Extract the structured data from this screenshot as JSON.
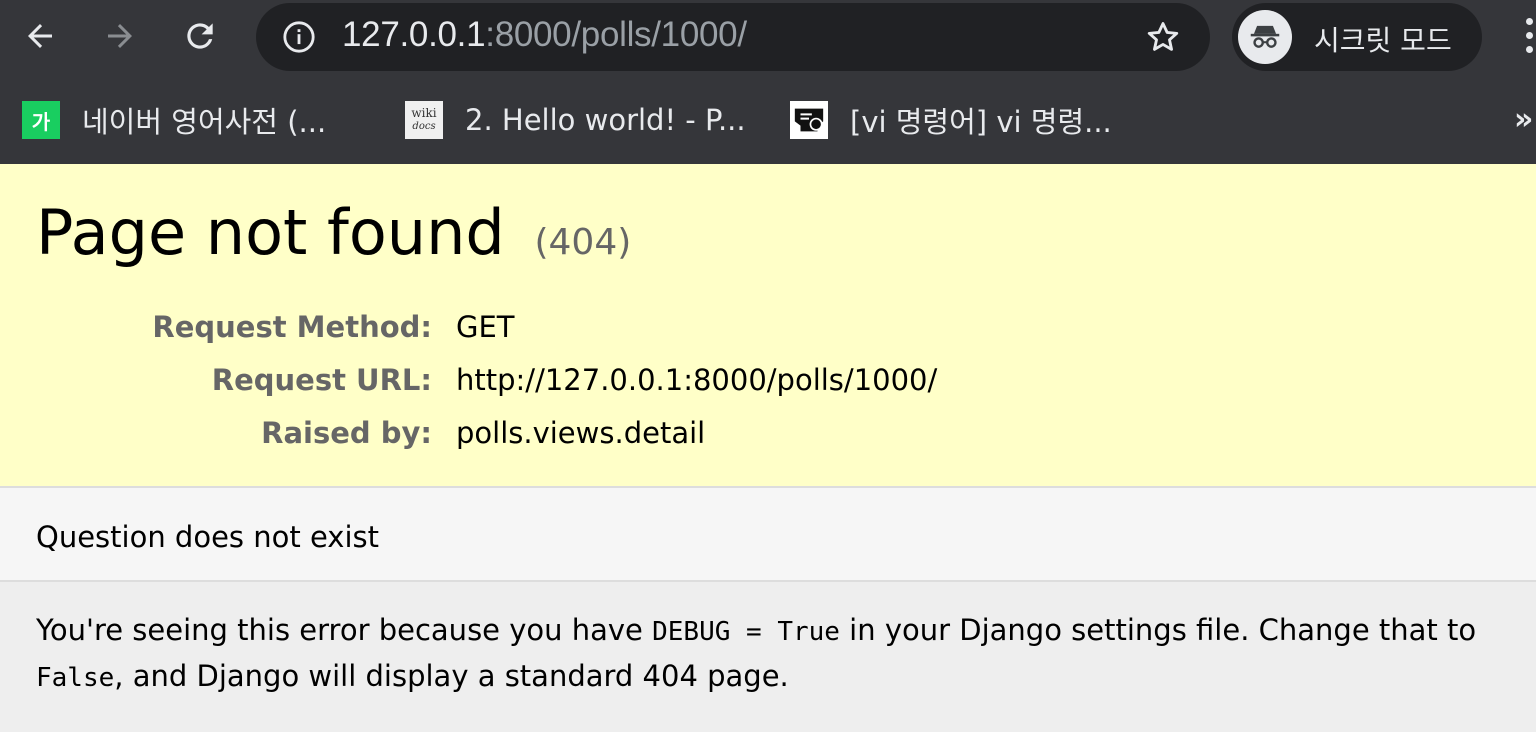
{
  "browser": {
    "url_host": "127.0.0.1",
    "url_rest": ":8000/polls/1000/",
    "incognito_label": "시크릿 모드",
    "bookmarks": [
      {
        "label": "네이버 영어사전 (...",
        "icon": "naver-dict-icon"
      },
      {
        "label": "2. Hello world! - P...",
        "icon": "wikidocs-icon"
      },
      {
        "label": "[vi 명령어] vi 명령...",
        "icon": "vi-icon"
      }
    ],
    "overflow": "»"
  },
  "summary": {
    "title": "Page not found",
    "code": "(404)",
    "rows": [
      {
        "key": "Request Method:",
        "value": "GET"
      },
      {
        "key": "Request URL:",
        "value": "http://127.0.0.1:8000/polls/1000/"
      },
      {
        "key": "Raised by:",
        "value": "polls.views.detail"
      }
    ]
  },
  "info": {
    "message": "Question does not exist"
  },
  "explanation": {
    "part1": "You're seeing this error because you have ",
    "code1": "DEBUG = True",
    "part2": " in your Django settings file. Change that to ",
    "code2": "False",
    "part3": ", and Django will display a standard 404 page."
  },
  "colors": {
    "chrome_bg": "#35363a",
    "omnibox_bg": "#202124",
    "summary_bg": "#ffffc8",
    "info_bg": "#f6f6f6",
    "explanation_bg": "#eeeeee"
  }
}
